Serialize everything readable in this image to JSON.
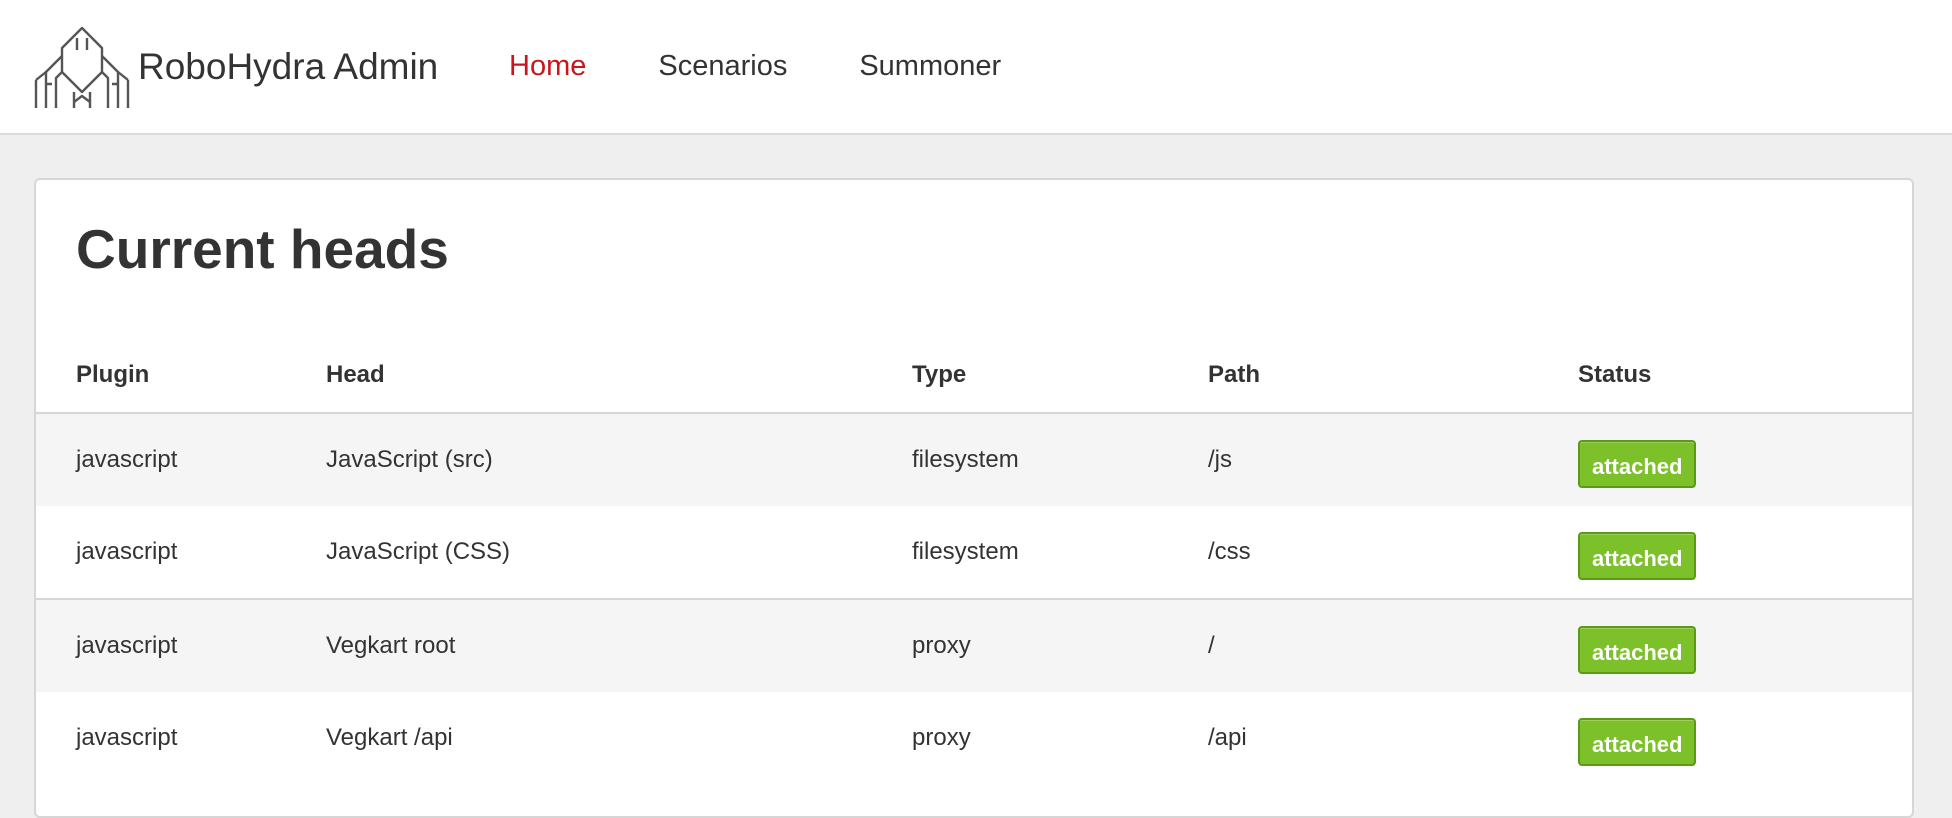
{
  "app": {
    "brand": "RoboHydra Admin",
    "logo_icon": "hydra-logo-icon"
  },
  "nav": {
    "items": [
      {
        "label": "Home",
        "active": true
      },
      {
        "label": "Scenarios",
        "active": false
      },
      {
        "label": "Summoner",
        "active": false
      }
    ]
  },
  "colors": {
    "active_nav": "#c9151b",
    "badge": "#7cc02a"
  },
  "main": {
    "title": "Current heads",
    "table": {
      "columns": [
        "Plugin",
        "Head",
        "Type",
        "Path",
        "Status"
      ],
      "rows": [
        {
          "plugin": "javascript",
          "head": "JavaScript (src)",
          "type": "filesystem",
          "path": "/js",
          "status": "attached"
        },
        {
          "plugin": "javascript",
          "head": "JavaScript (CSS)",
          "type": "filesystem",
          "path": "/css",
          "status": "attached"
        },
        {
          "plugin": "javascript",
          "head": "Vegkart root",
          "type": "proxy",
          "path": "/",
          "status": "attached"
        },
        {
          "plugin": "javascript",
          "head": "Vegkart /api",
          "type": "proxy",
          "path": "/api",
          "status": "attached"
        }
      ]
    }
  }
}
